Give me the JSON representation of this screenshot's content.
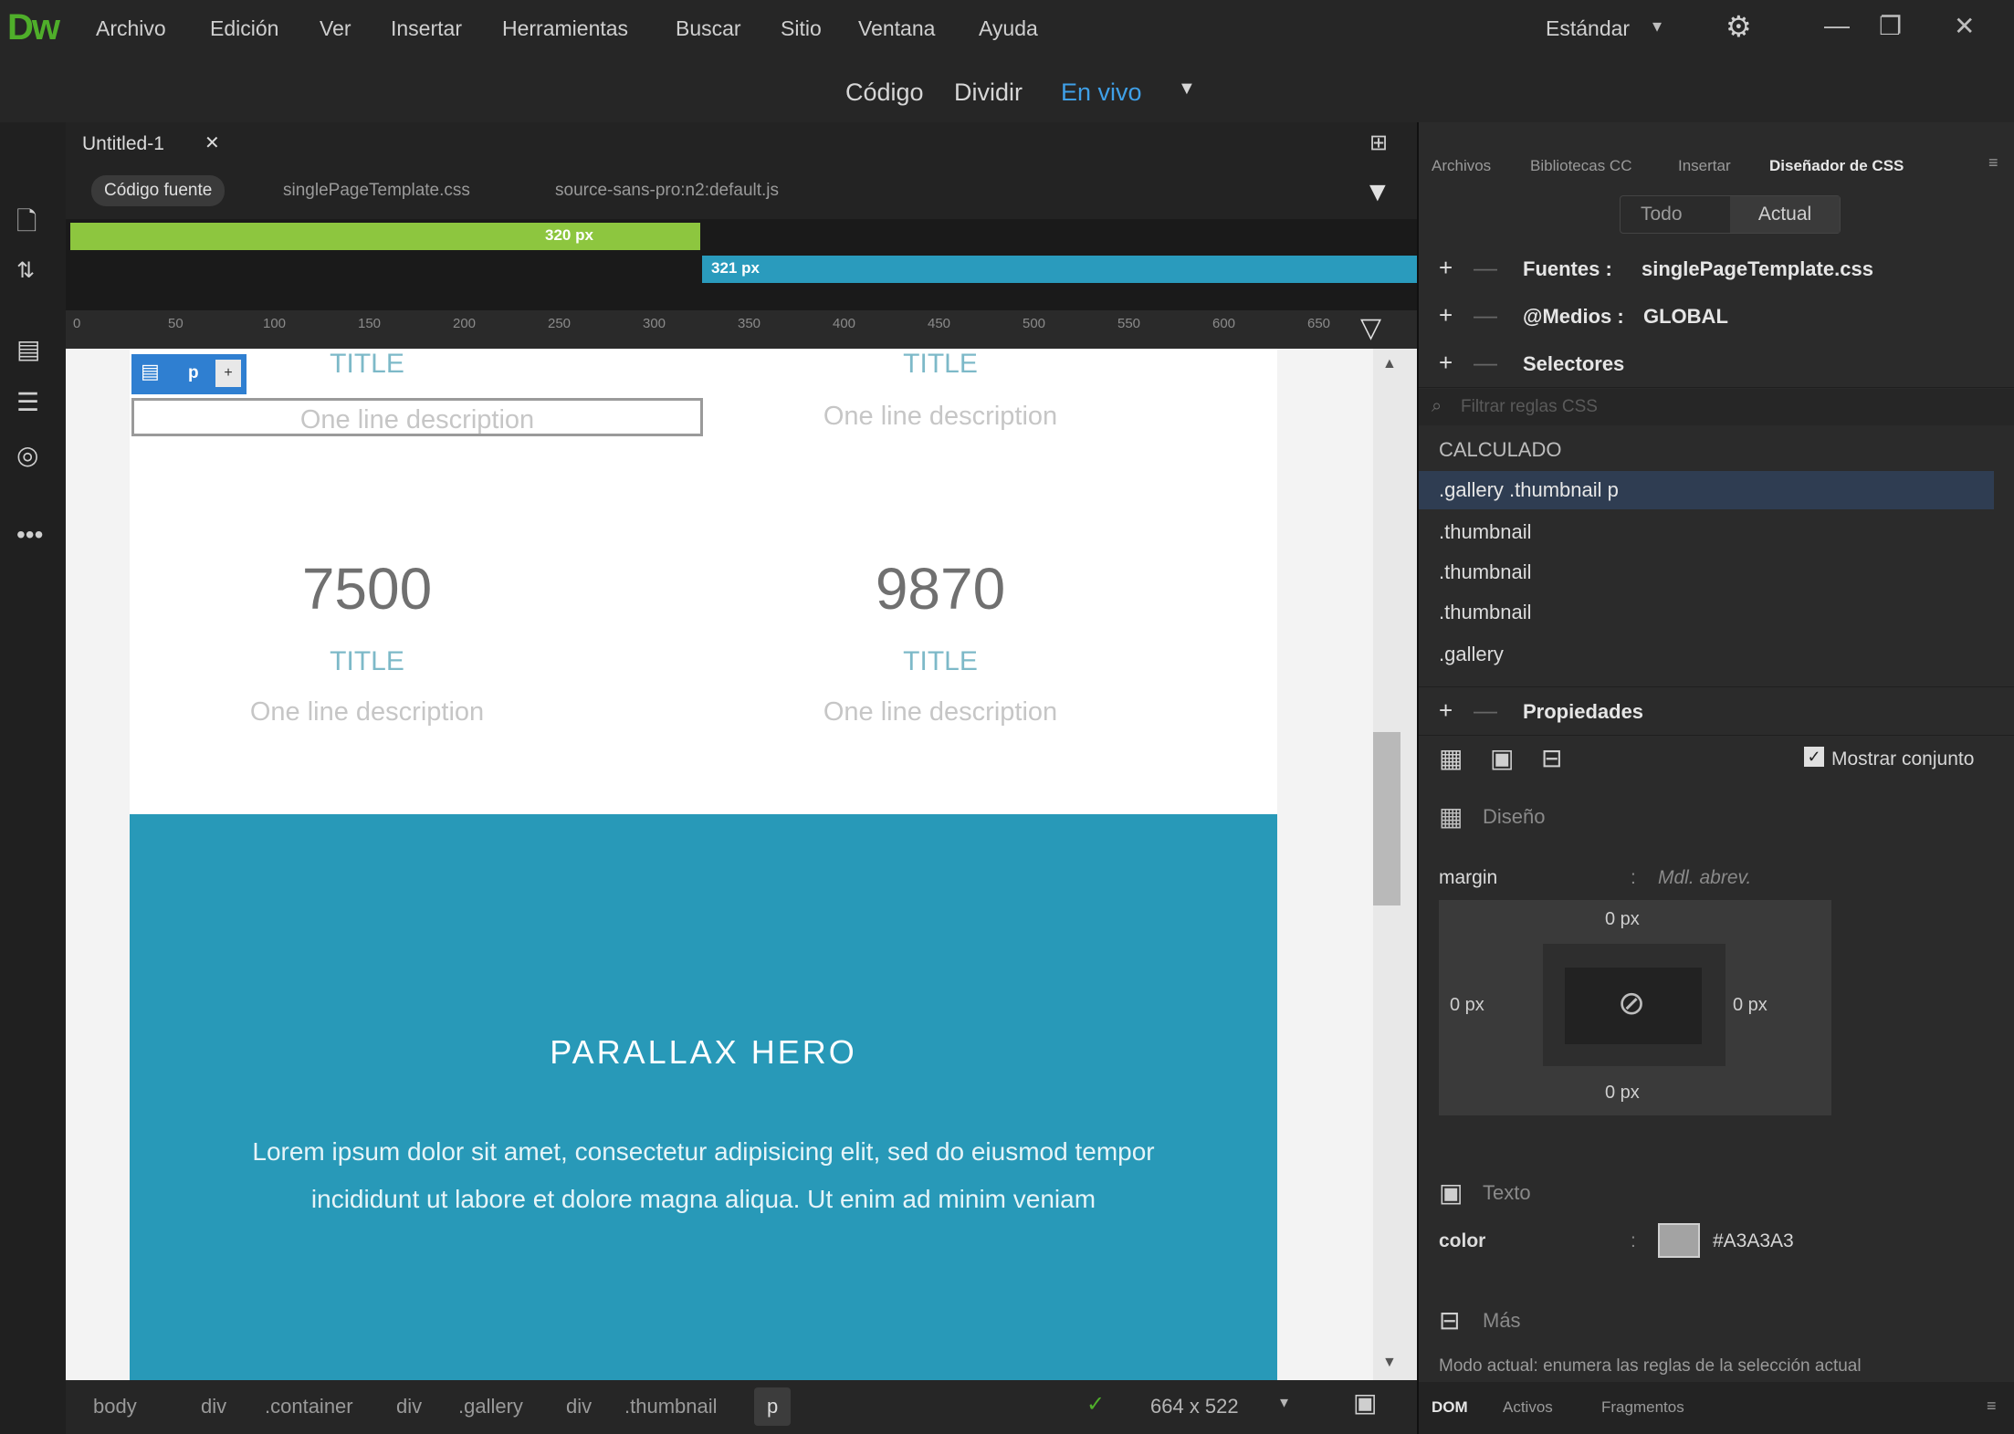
{
  "app": {
    "logo": "Dw"
  },
  "menubar": {
    "items": [
      "Archivo",
      "Edición",
      "Ver",
      "Insertar",
      "Herramientas",
      "Buscar",
      "Sitio",
      "Ventana",
      "Ayuda"
    ],
    "workspace": "Estándar"
  },
  "viewbar": {
    "code": "Código",
    "split": "Dividir",
    "live": "En vivo"
  },
  "document": {
    "tab": "Untitled-1",
    "related_files": [
      "Código fuente",
      "singlePageTemplate.css",
      "source-sans-pro:n2:default.js"
    ],
    "mq_green": "320 px",
    "mq_blue": "321 px",
    "ruler_ticks": [
      "0",
      "50",
      "100",
      "150",
      "200",
      "250",
      "300",
      "350",
      "400",
      "450",
      "500",
      "550",
      "600",
      "650"
    ]
  },
  "canvas": {
    "tag_label": "p",
    "top_items": [
      {
        "title": "TITLE",
        "desc": "One line description"
      },
      {
        "title": "TITLE",
        "desc": "One line description"
      }
    ],
    "stats": [
      {
        "number": "7500",
        "title": "TITLE",
        "desc": "One line description"
      },
      {
        "number": "9870",
        "title": "TITLE",
        "desc": "One line description"
      }
    ],
    "hero": {
      "heading": "PARALLAX HERO",
      "text_line1": "Lorem ipsum dolor sit amet, consectetur adipisicing elit, sed do eiusmod tempor",
      "text_line2": "incididunt ut labore et dolore magna aliqua. Ut enim ad minim veniam"
    }
  },
  "statusbar": {
    "breadcrumbs": [
      "body",
      "div",
      ".container",
      "div",
      ".gallery",
      "div",
      ".thumbnail",
      "p"
    ],
    "size": "664 x 522"
  },
  "panel": {
    "tabs": [
      "Archivos",
      "Bibliotecas CC",
      "Insertar",
      "Diseñador de CSS"
    ],
    "subtabs": {
      "all": "Todo",
      "current": "Actual"
    },
    "sources_label": "Fuentes :",
    "sources_value": "singlePageTemplate.css",
    "media_label": "@Medios :",
    "media_value": "GLOBAL",
    "selectors_label": "Selectores",
    "filter_placeholder": "Filtrar reglas CSS",
    "computed": "CALCULADO",
    "selectors": [
      ".gallery .thumbnail p",
      ".thumbnail",
      ".thumbnail",
      ".thumbnail",
      ".gallery"
    ],
    "properties_label": "Propiedades",
    "show_set": "Mostrar conjunto",
    "layout_label": "Diseño",
    "margin_label": "margin",
    "margin_hint": "Mdl. abrev.",
    "margin_top": "0 px",
    "margin_right": "0 px",
    "margin_bottom": "0 px",
    "margin_left": "0 px",
    "text_label": "Texto",
    "color_label": "color",
    "color_value": "#A3A3A3",
    "more_label": "Más",
    "mode_text": "Modo actual: enumera las reglas de la selección actual",
    "bottom_tabs": [
      "DOM",
      "Activos",
      "Fragmentos"
    ]
  },
  "colors": {
    "hero": "#2899b8",
    "mq_green": "#8dc63f",
    "mq_blue": "#2a9bbd",
    "selected_row": "#2f3d52",
    "swatch": "#A3A3A3"
  }
}
